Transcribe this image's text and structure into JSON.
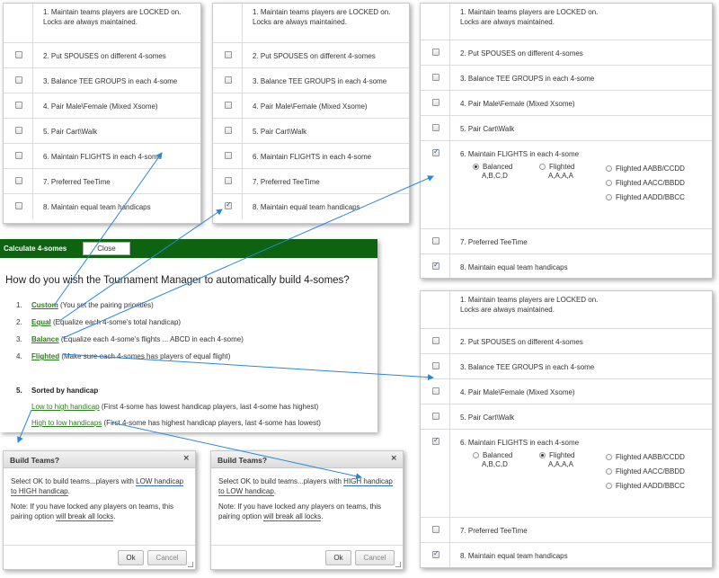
{
  "options": [
    "1. Maintain teams players are LOCKED on.\nLocks are always maintained.",
    "2. Put SPOUSES on different 4-somes",
    "3. Balance TEE GROUPS in each 4-some",
    "4. Pair Male\\Female (Mixed Xsome)",
    "5. Pair Cart\\Walk",
    "6. Maintain FLIGHTS in each 4-some",
    "7. Preferred TeeTime",
    "8. Maintain equal team handicaps"
  ],
  "option_line1": "1. Maintain teams players are LOCKED on.",
  "option_line2": "Locks are always maintained.",
  "flight_radios": {
    "balanced": "Balanced",
    "balanced_sub": "A,B,C,D",
    "flighted": "Flighted",
    "flighted_sub": "A,A,A,A",
    "aabb": "Flighted AABB/CCDD",
    "aacc": "Flighted AACC/BBDD",
    "aadd": "Flighted AADD/BBCC"
  },
  "calc": {
    "title": "Calculate 4-somes",
    "close": "Close",
    "question": "How do you wish the Tournament Manager to automatically build 4-somes?",
    "items": [
      {
        "num": "1.",
        "link": "Custom",
        "desc": "(You set the pairing priorities)"
      },
      {
        "num": "2.",
        "link": "Equal",
        "desc": "(Equalize each 4-some's total handicap)"
      },
      {
        "num": "3.",
        "link": "Balance",
        "desc": "(Equalize each 4-some's flights ... ABCD in each 4-some)"
      },
      {
        "num": "4.",
        "link": "Flighted",
        "desc": "(Make sure each 4-somes has players of equal flight)"
      }
    ],
    "sorted_num": "5.",
    "sorted_label": "Sorted by handicap",
    "low_link": "Low to high handicap",
    "low_desc": "(First 4-some has lowest handicap players, last 4-some has highest)",
    "high_link": "High to low handicaps",
    "high_desc": "(First 4-some has highest handicap players, last 4-some has lowest)"
  },
  "build_low": {
    "title": "Build Teams?",
    "close": "×",
    "p1_a": "Select OK to build teams...players with ",
    "p1_u": "LOW handicap to HIGH handicap",
    "p1_b": ".",
    "p2_a": "Note: If you have locked any players on teams, this pairing option ",
    "p2_u": "will break all locks",
    "p2_b": ".",
    "ok": "Ok",
    "cancel": "Cancel"
  },
  "build_high": {
    "title": "Build Teams?",
    "close": "×",
    "p1_a": "Select OK to build teams...players with ",
    "p1_u": "HIGH handicap to LOW handicap",
    "p1_b": ".",
    "p2_a": "Note: If you have locked any players on teams, this pairing option ",
    "p2_u": "will break all locks",
    "p2_b": ".",
    "ok": "Ok",
    "cancel": "Cancel"
  },
  "colors": {
    "bar_green": "#0d6310",
    "link_green": "#2f7d1f",
    "arrow_blue": "#2a86d8"
  }
}
